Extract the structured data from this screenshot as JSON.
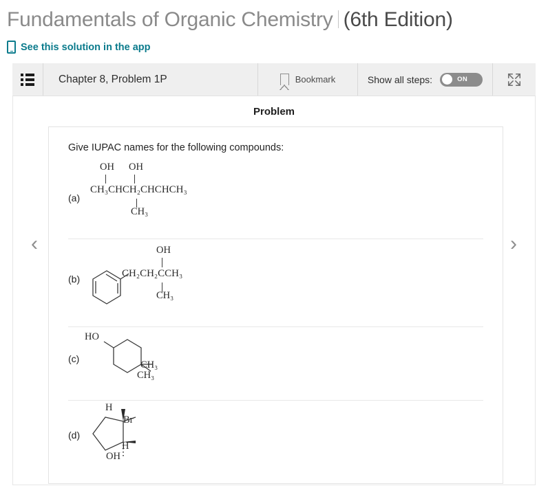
{
  "header": {
    "book_title": "Fundamentals of Organic Chemistry",
    "edition": "(6th Edition)",
    "app_link": "See this solution in the app",
    "phone_icon": "mobile-phone-icon",
    "link_color": "#0b7b8c"
  },
  "toolbar": {
    "menu_icon": "list-menu-icon",
    "chapter": "Chapter 8, Problem 1P",
    "bookmark_icon": "bookmark-icon",
    "bookmark_label": "Bookmark",
    "steps_label": "Show all steps:",
    "toggle_state": "ON",
    "expand_icon": "expand-arrows-icon"
  },
  "body": {
    "section_heading": "Problem",
    "prev_arrow": "‹",
    "next_arrow": "›",
    "prompt": "Give IUPAC names for the following compounds:"
  },
  "compounds": {
    "a": {
      "label": "(a)",
      "oh1": "OH",
      "oh2": "OH",
      "main": "CH₃CHCH₂CHCHCH₃",
      "branch": "CH₃"
    },
    "b": {
      "label": "(b)",
      "ring": "benzene-ring",
      "oh": "OH",
      "main": "CH₂CH₂CCH₃",
      "branch": "CH₃"
    },
    "c": {
      "label": "(c)",
      "ring": "cyclohexane-ring",
      "ho": "HO",
      "methyl1": "CH₃",
      "methyl2": "CH₃"
    },
    "d": {
      "label": "(d)",
      "ring": "cyclopentane-ring",
      "h_top": "H",
      "br": "Br",
      "h_bottom": "H",
      "oh": "OH"
    }
  }
}
